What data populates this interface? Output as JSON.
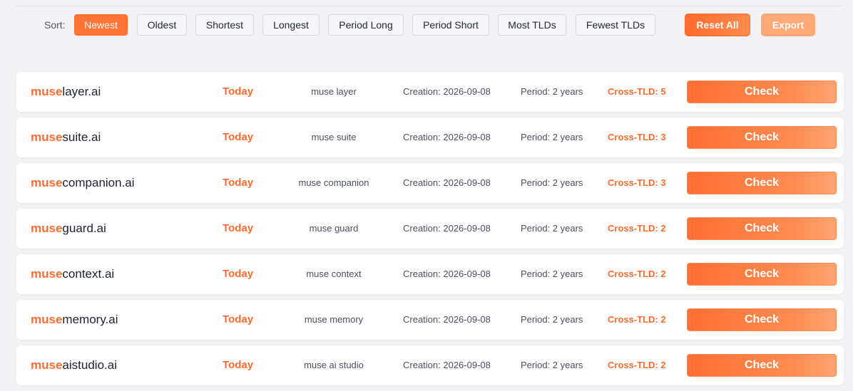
{
  "toolbar": {
    "sort_label": "Sort:",
    "sort_options": [
      "Newest",
      "Oldest",
      "Shortest",
      "Longest",
      "Period Long",
      "Period Short",
      "Most TLDs",
      "Fewest TLDs"
    ],
    "active_sort": "Newest",
    "reset_label": "Reset All",
    "export_label": "Export"
  },
  "rows": [
    {
      "prefix": "muse",
      "rest": "layer.ai",
      "when": "Today",
      "words": "muse layer",
      "created": "Creation: 2026-09-08",
      "period": "Period: 2 years",
      "cross": "Cross-TLD: 5",
      "action": "Check"
    },
    {
      "prefix": "muse",
      "rest": "suite.ai",
      "when": "Today",
      "words": "muse suite",
      "created": "Creation: 2026-09-08",
      "period": "Period: 2 years",
      "cross": "Cross-TLD: 3",
      "action": "Check"
    },
    {
      "prefix": "muse",
      "rest": "companion.ai",
      "when": "Today",
      "words": "muse companion",
      "created": "Creation: 2026-09-08",
      "period": "Period: 2 years",
      "cross": "Cross-TLD: 3",
      "action": "Check"
    },
    {
      "prefix": "muse",
      "rest": "guard.ai",
      "when": "Today",
      "words": "muse guard",
      "created": "Creation: 2026-09-08",
      "period": "Period: 2 years",
      "cross": "Cross-TLD: 2",
      "action": "Check"
    },
    {
      "prefix": "muse",
      "rest": "context.ai",
      "when": "Today",
      "words": "muse context",
      "created": "Creation: 2026-09-08",
      "period": "Period: 2 years",
      "cross": "Cross-TLD: 2",
      "action": "Check"
    },
    {
      "prefix": "muse",
      "rest": "memory.ai",
      "when": "Today",
      "words": "muse memory",
      "created": "Creation: 2026-09-08",
      "period": "Period: 2 years",
      "cross": "Cross-TLD: 2",
      "action": "Check"
    },
    {
      "prefix": "muse",
      "rest": "aistudio.ai",
      "when": "Today",
      "words": "muse ai studio",
      "created": "Creation: 2026-09-08",
      "period": "Period: 2 years",
      "cross": "Cross-TLD: 2",
      "action": "Check"
    }
  ],
  "colors": {
    "accent": "#ff6b2c",
    "background": "#f3f3f5",
    "card": "#ffffff"
  }
}
